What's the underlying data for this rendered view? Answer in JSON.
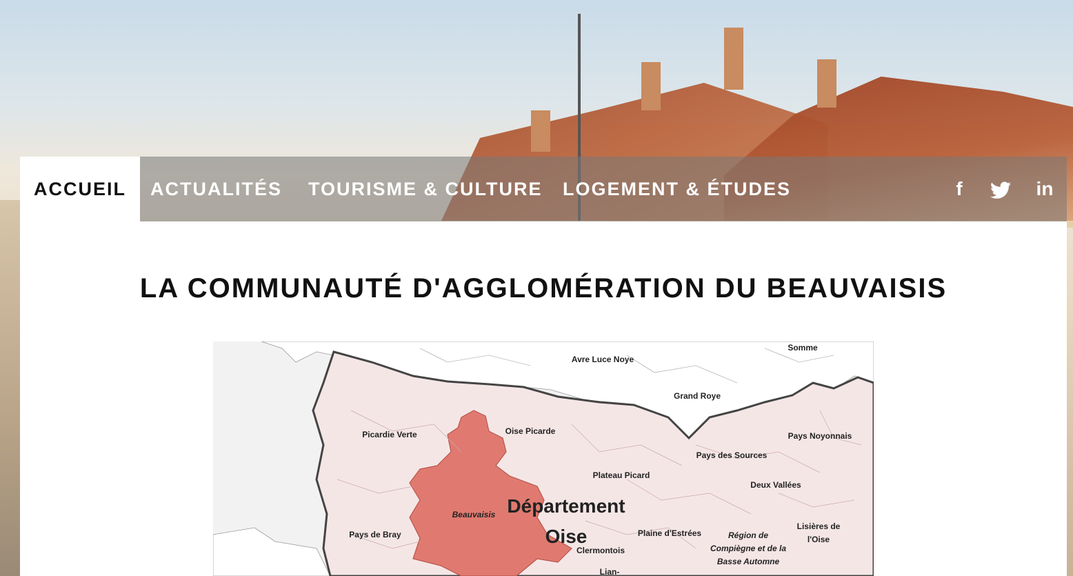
{
  "nav": {
    "items": [
      {
        "label": "ACCUEIL",
        "active": true
      },
      {
        "label": "ACTUALITÉS"
      },
      {
        "label": "TOURISME & CULTURE"
      },
      {
        "label": "LOGEMENT & ÉTUDES"
      }
    ],
    "social": [
      {
        "icon": "facebook-icon",
        "glyph": "f"
      },
      {
        "icon": "twitter-icon",
        "glyph": "🐦"
      },
      {
        "icon": "linkedin-icon",
        "glyph": "in"
      }
    ]
  },
  "main": {
    "title": "LA COMMUNAUTÉ D'AGGLOMÉRATION DU BEAUVAISIS"
  },
  "map": {
    "labels": {
      "somme": "Somme",
      "avre": "Avre Luce Noye",
      "grand_roye": "Grand Roye",
      "picardie_verte": "Picardie Verte",
      "oise_picarde": "Oise Picarde",
      "pays_noyonnais": "Pays Noyonnais",
      "pays_sources": "Pays des Sources",
      "plateau": "Plateau Picard",
      "deux_vallees": "Deux Vallées",
      "beauvaisis": "Beauvaisis",
      "departement": "Département",
      "oise": "Oise",
      "pays_bray": "Pays de Bray",
      "plaine": "Plaine d'Estrées",
      "lisieres1": "Lisières de",
      "lisieres2": "l'Oise",
      "region1": "Région de",
      "region2": "Compiègne et de la",
      "region3": "Basse Automne",
      "clermontois": "Clermontois",
      "lian": "Lian-"
    },
    "colors": {
      "highlight": "#e07a70",
      "oise_fill": "#f5e6e6",
      "outside_fill": "#ffffff",
      "border": "#444444"
    }
  }
}
